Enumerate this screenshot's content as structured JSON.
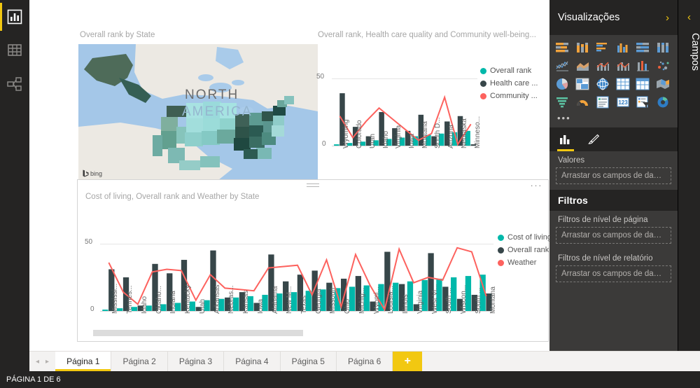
{
  "app": {
    "left_nav": [
      {
        "label": "Relatório",
        "icon": "report-bar-chart-icon",
        "active": true
      },
      {
        "label": "Dados",
        "icon": "data-table-icon",
        "active": false
      },
      {
        "label": "Modelo",
        "icon": "model-relationships-icon",
        "active": false
      }
    ]
  },
  "visualizations_panel": {
    "title": "Visualizações",
    "collapse_chevron": "›",
    "more_visuals": "•••",
    "icons": [
      "stacked-bar-chart-icon",
      "stacked-column-chart-icon",
      "clustered-bar-chart-icon",
      "clustered-column-chart-icon",
      "100-stacked-bar-chart-icon",
      "100-stacked-column-chart-icon",
      "line-chart-icon",
      "area-chart-icon",
      "stacked-area-chart-icon",
      "line-and-stacked-column-chart-icon",
      "ribbon-chart-icon",
      "scatter-chart-icon",
      "pie-chart-icon",
      "treemap-icon",
      "globe-map-icon",
      "table-icon",
      "matrix-icon",
      "filled-map-icon",
      "funnel-icon",
      "gauge-icon",
      "multi-row-card-icon",
      "card-icon",
      "slicer-icon",
      "donut-chart-icon"
    ],
    "tabs": [
      {
        "name": "fields-tab",
        "icon": "bar-chart-icon",
        "active": true
      },
      {
        "name": "format-tab",
        "icon": "paintbrush-icon",
        "active": false
      }
    ],
    "values_label": "Valores",
    "values_dropzone": "Arrastar os campos de dado..."
  },
  "filters_panel": {
    "title": "Filtros",
    "page_level_label": "Filtros de nível de página",
    "page_level_dropzone": "Arrastar os campos de dado...",
    "report_level_label": "Filtros de nível de relatório",
    "report_level_dropzone": "Arrastar os campos de dado..."
  },
  "fields_strip": {
    "title": "Campos",
    "collapse_chevron": "‹"
  },
  "page_tabs": {
    "prev_arrow": "◂",
    "next_arrow": "▸",
    "add_label": "+",
    "items": [
      {
        "label": "Página 1",
        "active": true
      },
      {
        "label": "Página 2",
        "active": false
      },
      {
        "label": "Página 3",
        "active": false
      },
      {
        "label": "Página 4",
        "active": false
      },
      {
        "label": "Página 5",
        "active": false
      },
      {
        "label": "Página 6",
        "active": false
      }
    ]
  },
  "status_bar": {
    "text": "PÁGINA 1 DE 6"
  },
  "map_visual": {
    "title": "Overall rank by State",
    "region_label_line1": "NORTH",
    "region_label_line2": "AMERICA",
    "attribution": "bing"
  },
  "bottom_visual_chrome": {
    "ellipsis": "···"
  },
  "colors": {
    "teal": "#01b8aa",
    "dark": "#374649",
    "red": "#fd625e",
    "accent_yellow": "#f2c811",
    "panel_dark": "#252423",
    "panel_mid": "#3b3a39"
  },
  "chart_data": [
    {
      "id": "top-chart",
      "type": "bar",
      "title": "Overall rank, Health care quality and Community well-being...",
      "xlabel": "",
      "ylabel": "",
      "ylim": [
        0,
        50
      ],
      "yticks": [
        "0",
        "50"
      ],
      "grid": true,
      "legend_position": "right",
      "categories": [
        "Wyoming",
        "Colorado",
        "Utah",
        "Idaho",
        "Virginia",
        "Iowa",
        "Montana",
        "South D...",
        "Arizona",
        "Nebraska",
        "Minneso..."
      ],
      "series": [
        {
          "name": "Overall rank",
          "kind": "column",
          "color": "#01b8aa",
          "values": [
            1,
            2,
            3,
            4,
            5,
            6,
            7,
            8,
            9,
            10,
            11
          ]
        },
        {
          "name": "Health care ...",
          "kind": "column",
          "color": "#374649",
          "values": [
            39,
            14,
            7,
            25,
            13,
            11,
            23,
            7,
            18,
            22,
            1
          ]
        },
        {
          "name": "Community ...",
          "kind": "line",
          "color": "#fd625e",
          "values": [
            22,
            6,
            18,
            28,
            20,
            12,
            4,
            9,
            36,
            1,
            16,
            7
          ]
        }
      ],
      "legend": [
        "Overall rank",
        "Health care ...",
        "Community ..."
      ]
    },
    {
      "id": "bottom-chart",
      "type": "bar",
      "title": "Cost of living, Overall rank and Weather by State",
      "xlabel": "",
      "ylabel": "",
      "ylim": [
        0,
        50
      ],
      "yticks": [
        "0",
        "50"
      ],
      "grid": true,
      "legend_position": "right",
      "categories": [
        "Mississi...",
        "Tennes...",
        "Idaho",
        "Oklaho...",
        "Indiana",
        "Kentucky",
        "Utah",
        "Arkansas",
        "Nebras...",
        "Kansas",
        "Iowa",
        "Alabama",
        "New M...",
        "Texas",
        "Georgia",
        "Missouri",
        "Ohio",
        "Michig...",
        "Wyomi...",
        "Louisia...",
        "Illinois",
        "Virginia",
        "West Vi...",
        "South ...",
        "Wiscon...",
        "South ...",
        "Montana"
      ],
      "series": [
        {
          "name": "Cost of living",
          "kind": "column",
          "color": "#01b8aa",
          "values": [
            1,
            2,
            3,
            4,
            5,
            6,
            7,
            8,
            9,
            10,
            11,
            12,
            13,
            14,
            15,
            16,
            17,
            18,
            19,
            20,
            21,
            22,
            23,
            24,
            25,
            26,
            27
          ]
        },
        {
          "name": "Overall rank",
          "kind": "column",
          "color": "#374649",
          "values": [
            31,
            25,
            4,
            35,
            28,
            38,
            3,
            45,
            10,
            14,
            6,
            42,
            22,
            27,
            30,
            21,
            24,
            26,
            7,
            44,
            20,
            5,
            43,
            18,
            9,
            12,
            13
          ]
        },
        {
          "name": "Weather",
          "kind": "line",
          "color": "#fd625e",
          "values": [
            36,
            14,
            5,
            29,
            31,
            30,
            8,
            27,
            17,
            16,
            15,
            32,
            33,
            34,
            12,
            38,
            3,
            42,
            19,
            1,
            46,
            21,
            25,
            23,
            47,
            44,
            11
          ]
        }
      ],
      "legend": [
        "Cost of living",
        "Overall rank",
        "Weather"
      ]
    }
  ]
}
